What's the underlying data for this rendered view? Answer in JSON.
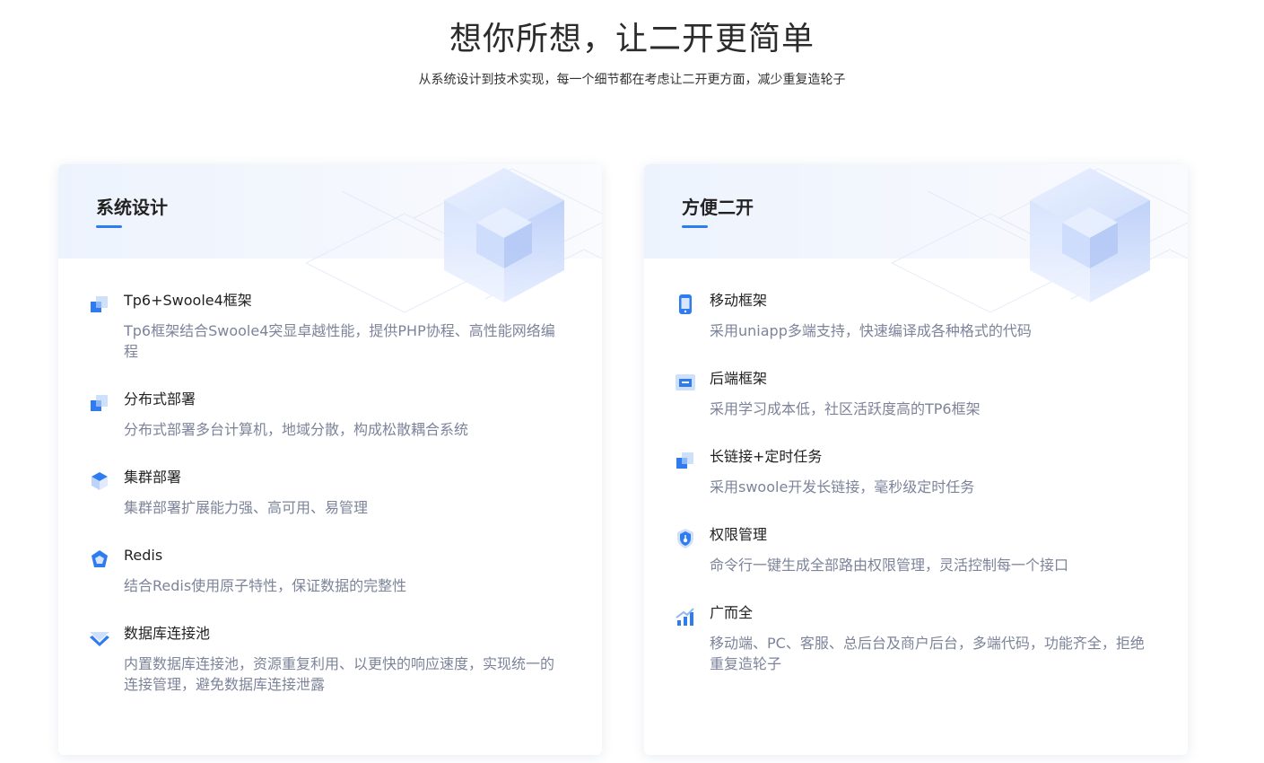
{
  "hero": {
    "title": "想你所想，让二开更简单",
    "subtitle": "从系统设计到技术实现，每一个细节都在考虑让二开更方面，减少重复造轮子"
  },
  "cards": [
    {
      "title": "系统设计",
      "items": [
        {
          "icon": "stacked-squares-icon",
          "title": "Tp6+Swoole4框架",
          "desc": "Tp6框架结合Swoole4突显卓越性能，提供PHP协程、高性能网络编程"
        },
        {
          "icon": "stacked-squares-icon",
          "title": "分布式部署",
          "desc": "分布式部署多台计算机，地域分散，构成松散耦合系统"
        },
        {
          "icon": "cube-icon",
          "title": "集群部署",
          "desc": "集群部署扩展能力强、高可用、易管理"
        },
        {
          "icon": "redis-icon",
          "title": "Redis",
          "desc": "结合Redis使用原子特性，保证数据的完整性"
        },
        {
          "icon": "database-layers-icon",
          "title": "数据库连接池",
          "desc": "内置数据库连接池，资源重复利用、以更快的响应速度，实现统一的连接管理，避免数据库连接泄露"
        }
      ]
    },
    {
      "title": "方便二开",
      "items": [
        {
          "icon": "mobile-phone-icon",
          "title": "移动框架",
          "desc": "采用uniapp多端支持，快速编译成各种格式的代码"
        },
        {
          "icon": "monitor-icon",
          "title": "后端框架",
          "desc": "采用学习成本低，社区活跃度高的TP6框架"
        },
        {
          "icon": "stacked-squares-icon",
          "title": "长链接+定时任务",
          "desc": "采用swoole开发长链接，毫秒级定时任务"
        },
        {
          "icon": "shield-key-icon",
          "title": "权限管理",
          "desc": "命令行一键生成全部路由权限管理，灵活控制每一个接口"
        },
        {
          "icon": "bar-chart-icon",
          "title": "广而全",
          "desc": "移动端、PC、客服、总后台及商户后台，多端代码，功能齐全，拒绝重复造轮子"
        }
      ]
    }
  ],
  "colors": {
    "accent": "#2f7bf0",
    "desc_text": "#7d849a",
    "header_bg": "#edf3fd"
  }
}
